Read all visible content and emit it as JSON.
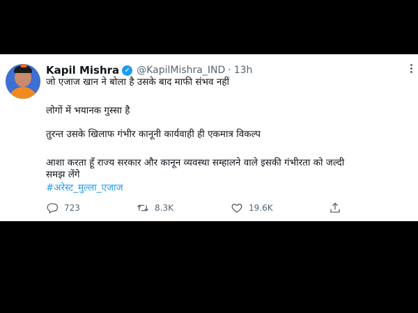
{
  "tweet": {
    "author_name": "Kapil Mishra",
    "handle": "@KapilMishra_IND",
    "separator": "·",
    "time": "13h",
    "lines": [
      "जो एजाज खान ने बोला है उसके बाद माफी संभव नहीं",
      "लोगों में भयानक गुस्सा है",
      "तुरन्त उसके खिलाफ गंभीर कानूनी कार्यवाही  ही एकमात्र विकल्प",
      "आशा करता हूँ राज्य सरकार और कानून व्यवस्था सम्हालने वाले इसकी गंभीरता को जल्दी",
      "समझ लेंगे"
    ],
    "hashtag": "#अरेस्ट_मुल्ला_एजाज",
    "replies": "723",
    "retweets": "8.3K",
    "likes": "19.6K"
  },
  "colors": {
    "accent": "#1d9bf0",
    "background": "#000000",
    "card": "#ffffff",
    "secondary_text": "#536471"
  },
  "icons": {
    "verified": "verified-badge-icon",
    "more": "more-options-icon",
    "reply": "reply-icon",
    "retweet": "retweet-icon",
    "like": "like-icon",
    "share": "share-icon"
  }
}
